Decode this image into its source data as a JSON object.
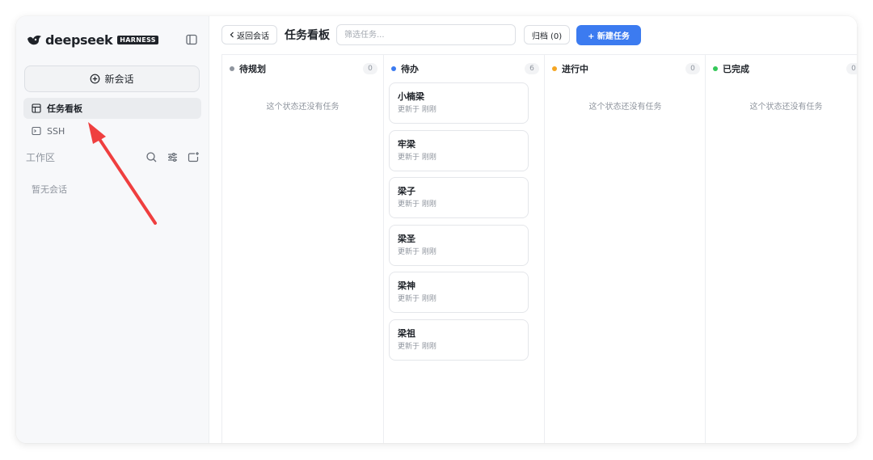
{
  "sidebar": {
    "brand_name": "deepseek",
    "brand_badge": "HARNESS",
    "new_chat_label": "新会话",
    "nav_items": [
      {
        "label": "任务看板",
        "icon": "board-icon",
        "active": true
      },
      {
        "label": "SSH",
        "icon": "terminal-icon",
        "active": false
      }
    ],
    "workspace_label": "工作区",
    "empty_sessions_text": "暂无会话"
  },
  "toolbar": {
    "back_label": "返回会话",
    "title": "任务看板",
    "filter_placeholder": "筛选任务...",
    "archive_label": "归档 (0)",
    "new_task_label": "+ 新建任务"
  },
  "board": {
    "columns": [
      {
        "title": "待规划",
        "count": "0",
        "color": "#8f959e",
        "empty_text": "这个状态还没有任务",
        "cards": []
      },
      {
        "title": "待办",
        "count": "6",
        "color": "#3c7bf0",
        "cards": [
          {
            "title": "小楠梁",
            "subtitle": "更新于 刚刚"
          },
          {
            "title": "牢梁",
            "subtitle": "更新于 刚刚"
          },
          {
            "title": "梁子",
            "subtitle": "更新于 刚刚"
          },
          {
            "title": "梁圣",
            "subtitle": "更新于 刚刚"
          },
          {
            "title": "梁神",
            "subtitle": "更新于 刚刚"
          },
          {
            "title": "梁祖",
            "subtitle": "更新于 刚刚"
          }
        ]
      },
      {
        "title": "进行中",
        "count": "0",
        "color": "#f5a623",
        "empty_text": "这个状态还没有任务",
        "cards": []
      },
      {
        "title": "已完成",
        "count": "0",
        "color": "#34c759",
        "empty_text": "这个状态还没有任务",
        "cards": []
      }
    ]
  },
  "colors": {
    "accent": "#3c7bf0",
    "annotation_arrow": "#ef3f3f"
  }
}
